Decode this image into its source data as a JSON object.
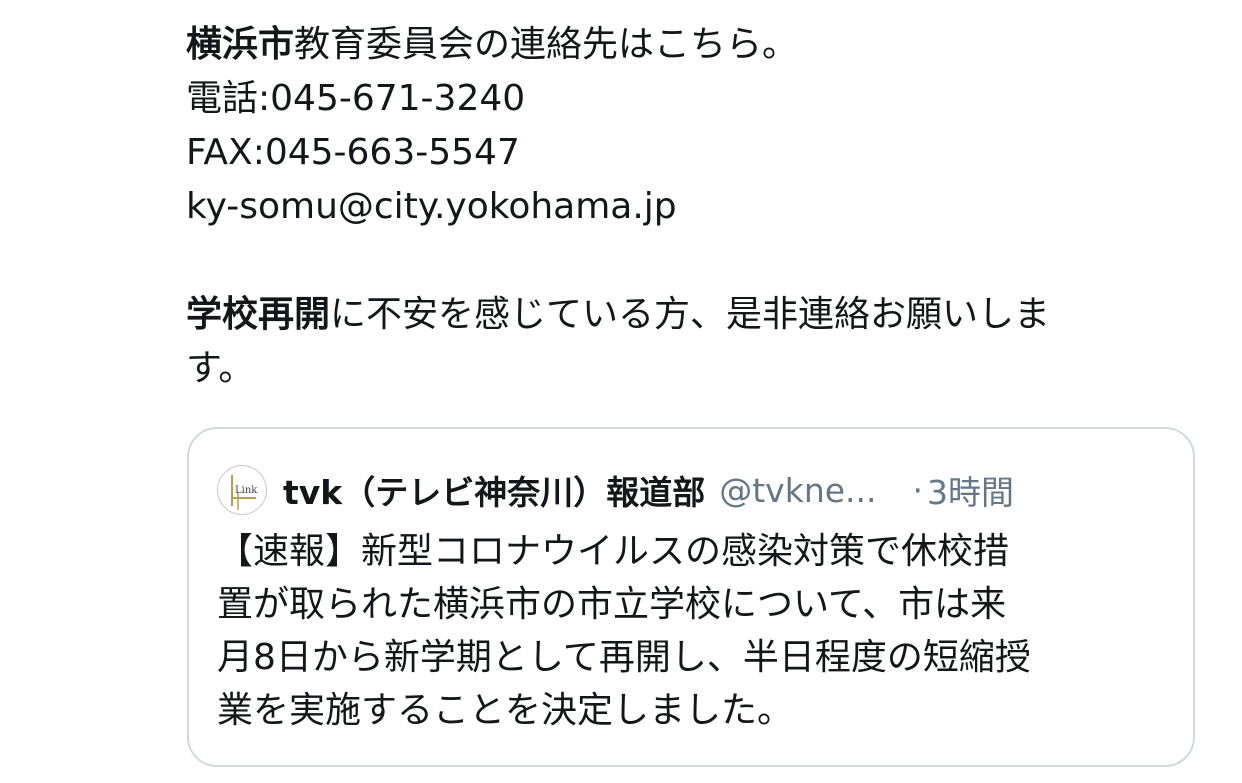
{
  "tweet": {
    "line1_bold": "横浜市",
    "line1_rest": "教育委員会の連絡先はこちら。",
    "line2": "電話:045-671-3240",
    "line3": "FAX:045-663-5547",
    "line4": "ky-somu@city.yokohama.jp",
    "line5_bold": "学校再開",
    "line5_rest": "に不安を感じている方、是非連絡お願いしま",
    "line6": "す。"
  },
  "quote": {
    "avatar_icon": "tvk-news-link-logo",
    "avatar_text": "Link",
    "name": "tvk（テレビ神奈川）報道部",
    "handle": "@tvkne...",
    "separator": "·",
    "time": "3時間",
    "body_lines": [
      "【速報】新型コロナウイルスの感染対策で休校措",
      "置が取られた横浜市の市立学校について、市は来",
      "月8日から新学期として再開し、半日程度の短縮授",
      "業を実施することを決定しました。"
    ]
  }
}
